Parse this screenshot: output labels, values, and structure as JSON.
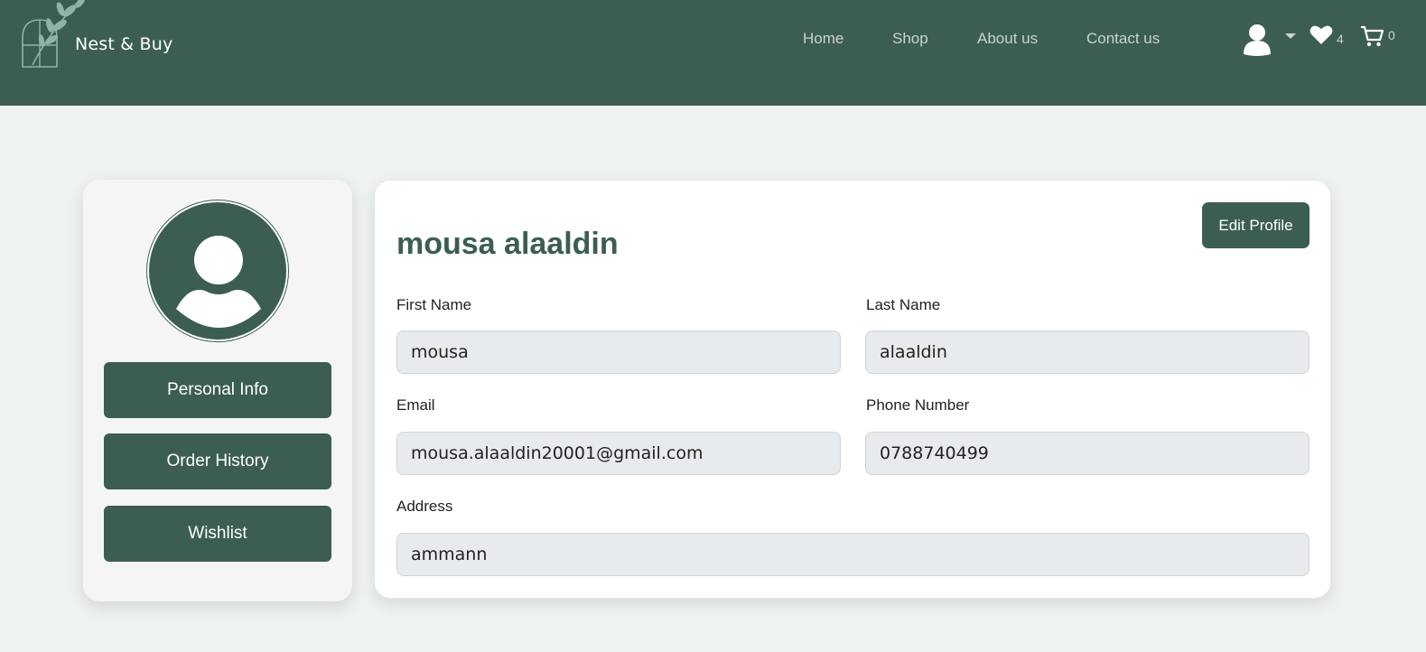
{
  "header": {
    "brand": "Nest & Buy",
    "nav": [
      "Home",
      "Shop",
      "About us",
      "Contact us"
    ],
    "wishlist_count": "4",
    "cart_count": "0",
    "colors": {
      "primary": "#3b5e50",
      "nav_text": "#c9d3cf",
      "page_bg": "#eff2f3"
    }
  },
  "sidebar": {
    "buttons": [
      "Personal Info",
      "Order History",
      "Wishlist"
    ]
  },
  "profile": {
    "name": "mousa alaaldin",
    "edit_label": "Edit Profile",
    "fields": {
      "first_name": {
        "label": "First Name",
        "value": "mousa"
      },
      "last_name": {
        "label": "Last Name",
        "value": "alaaldin"
      },
      "email": {
        "label": "Email",
        "value": "mousa.alaaldin20001@gmail.com"
      },
      "phone": {
        "label": "Phone Number",
        "value": "0788740499"
      },
      "address": {
        "label": "Address",
        "value": "ammann"
      }
    }
  },
  "icons": [
    "logo-leaf-icon",
    "user-icon",
    "caret-down-icon",
    "heart-icon",
    "cart-icon",
    "avatar-user-icon"
  ]
}
